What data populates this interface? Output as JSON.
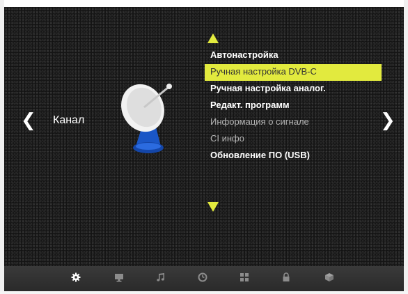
{
  "nav": {
    "category_label": "Канал",
    "left_arrow": "❮",
    "right_arrow": "❯"
  },
  "menu": {
    "items": [
      {
        "label": "Автонастройка",
        "state": "normal"
      },
      {
        "label": "Ручная настройка DVB-C",
        "state": "selected"
      },
      {
        "label": "Ручная настройка аналог.",
        "state": "normal"
      },
      {
        "label": "Редакт. программ",
        "state": "normal"
      },
      {
        "label": "Информация о сигнале",
        "state": "disabled"
      },
      {
        "label": "CI инфо",
        "state": "disabled"
      },
      {
        "label": "Обновление ПО (USB)",
        "state": "normal"
      }
    ]
  },
  "colors": {
    "accent": "#e2ea3e",
    "text": "#ffffff",
    "disabled_text": "#b4b4b4"
  },
  "bottom_bar": {
    "icons": [
      "settings-gear-icon",
      "monitor-icon",
      "music-note-icon",
      "clock-icon",
      "grid-icon",
      "lock-icon",
      "cube-icon"
    ],
    "active": "settings-gear-icon"
  }
}
